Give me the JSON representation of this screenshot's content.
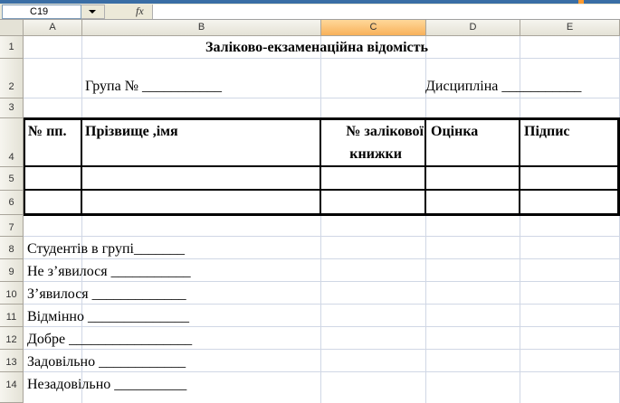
{
  "formula_bar": {
    "name_box": "C19",
    "fx_label": "fx"
  },
  "columns": [
    "A",
    "B",
    "C",
    "D",
    "E"
  ],
  "rows": [
    "1",
    "2",
    "3",
    "4",
    "5",
    "6",
    "7",
    "8",
    "9",
    "10",
    "11",
    "12",
    "13",
    "14"
  ],
  "sheet": {
    "title": "Заліково-екзаменаційна відомість",
    "group_label": "Група №  ___________",
    "discipline_label": "Дисципліна ___________",
    "table_headers": {
      "num": "№ пп.",
      "name": "Прізвище ,імя",
      "record_line1": "№ залікової",
      "record_line2": "книжки",
      "grade": "Оцінка",
      "signature": "Підпис"
    },
    "summary": [
      "Студентів в групі_______",
      "Не з’явилося ___________",
      "З’явилося _____________",
      "Відмінно ______________",
      "Добре _________________",
      "Задовільно ____________",
      "Незадовільно __________"
    ]
  }
}
